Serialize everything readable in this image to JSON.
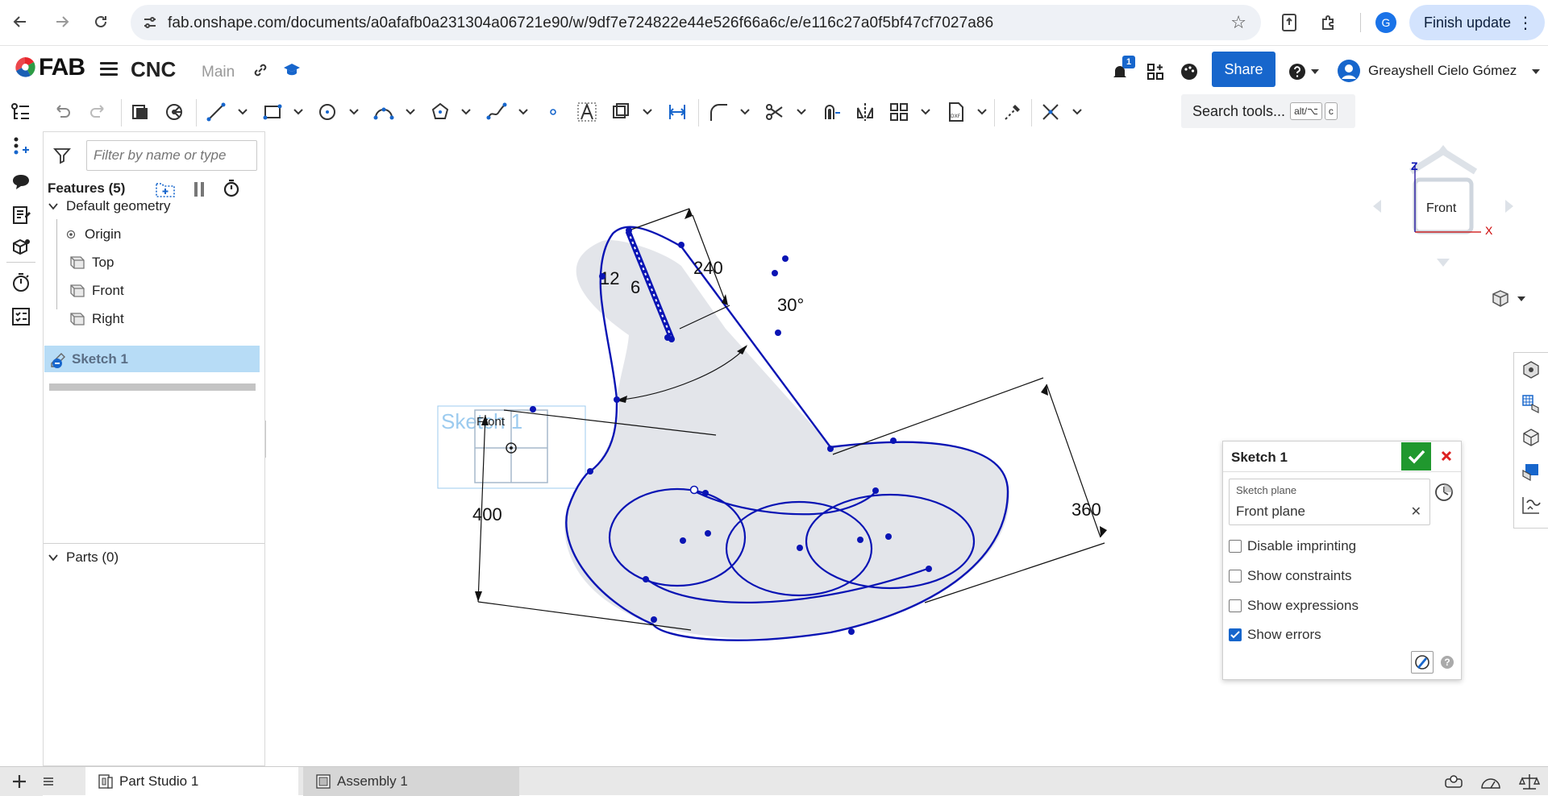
{
  "browser": {
    "url": "fab.onshape.com/documents/a0afafb0a231304a06721e90/w/9df7e724822e44e526f66a6c/e/e116c27a0f5bf47cf7027a86",
    "profile_initial": "G",
    "finish_update_label": "Finish update"
  },
  "header": {
    "logo_text": "FAB",
    "document_name": "CNC",
    "workspace": "Main",
    "notifications_count": "1",
    "share_label": "Share",
    "user_name": "Greayshell Cielo Gómez"
  },
  "toolbar": {
    "search_label": "Search tools...",
    "shortcut_key1": "alt/⌥",
    "shortcut_key2": "c"
  },
  "feature_panel": {
    "filter_placeholder": "Filter by name or type",
    "features_header": "Features (5)",
    "default_geometry_label": "Default geometry",
    "items": [
      {
        "label": "Origin",
        "icon": "origin-icon"
      },
      {
        "label": "Top",
        "icon": "plane-icon"
      },
      {
        "label": "Front",
        "icon": "plane-icon"
      },
      {
        "label": "Right",
        "icon": "plane-icon"
      }
    ],
    "sketch_item": "Sketch 1",
    "parts_header": "Parts (0)"
  },
  "viewport": {
    "sketch_label": "Sketch 1",
    "front_plane_label": "Front",
    "dimensions": {
      "d240": "240",
      "d12": "12",
      "d6": "6",
      "angle30": "30°",
      "d400": "400",
      "d360": "360"
    },
    "view_cube": {
      "face_label": "Front",
      "axis_z": "Z",
      "axis_x": "X"
    }
  },
  "sketch_dialog": {
    "title": "Sketch 1",
    "plane_label": "Sketch plane",
    "plane_value": "Front plane",
    "options": [
      {
        "label": "Disable imprinting",
        "checked": false
      },
      {
        "label": "Show constraints",
        "checked": false
      },
      {
        "label": "Show expressions",
        "checked": false
      },
      {
        "label": "Show errors",
        "checked": true
      }
    ]
  },
  "tabs": {
    "part_studio": "Part Studio 1",
    "assembly": "Assembly 1"
  },
  "colors": {
    "sketch_blue": "#0a14b4",
    "region_fill": "#e3e5ea",
    "share_blue": "#1766cc",
    "confirm_green": "#20982e",
    "selection_blue": "#b7dcf6"
  }
}
